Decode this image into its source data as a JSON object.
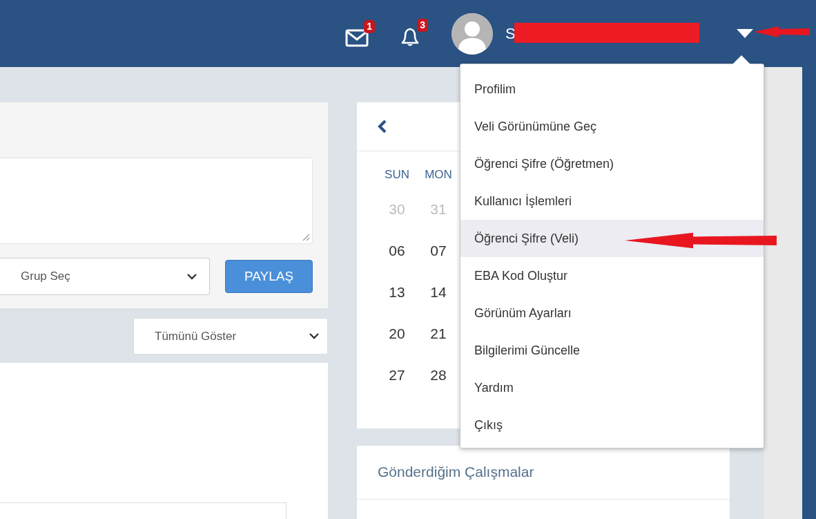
{
  "header": {
    "notifications": [
      {
        "kind": "mail",
        "count": "1"
      },
      {
        "kind": "bell",
        "count": "3"
      }
    ],
    "user": {
      "name": "S"
    },
    "menu_open": true
  },
  "post": {
    "group_select": "Grup Seç",
    "share_button": "PAYLAŞ"
  },
  "filter": {
    "value": "Tümünü Göster"
  },
  "calendar": {
    "weekdays": [
      "SUN",
      "MON"
    ],
    "weeks": [
      [
        {
          "day": "30",
          "muted": true
        },
        {
          "day": "31",
          "muted": true
        }
      ],
      [
        {
          "day": "06",
          "muted": false
        },
        {
          "day": "07",
          "muted": false
        }
      ],
      [
        {
          "day": "13",
          "muted": false
        },
        {
          "day": "14",
          "muted": false
        }
      ],
      [
        {
          "day": "20",
          "muted": false
        },
        {
          "day": "21",
          "muted": false
        }
      ],
      [
        {
          "day": "27",
          "muted": false
        },
        {
          "day": "28",
          "muted": false
        }
      ]
    ]
  },
  "works": {
    "title": "Gönderdiğim Çalışmalar"
  },
  "menu": {
    "items": [
      {
        "label": "Profilim",
        "selected": false
      },
      {
        "label": "Veli Görünümüne Geç",
        "selected": false
      },
      {
        "label": "Öğrenci Şifre (Öğretmen)",
        "selected": false
      },
      {
        "label": "Kullanıcı İşlemleri",
        "selected": false
      },
      {
        "label": "Öğrenci Şifre (Veli)",
        "selected": true
      },
      {
        "label": "EBA Kod Oluştur",
        "selected": false
      },
      {
        "label": "Görünüm Ayarları",
        "selected": false
      },
      {
        "label": "Bilgilerimi Güncelle",
        "selected": false
      },
      {
        "label": "Yardım",
        "selected": false
      },
      {
        "label": "Çıkış",
        "selected": false
      }
    ]
  },
  "annotations": [
    {
      "kind": "redaction"
    },
    {
      "kind": "arrow"
    },
    {
      "kind": "arrow"
    }
  ]
}
